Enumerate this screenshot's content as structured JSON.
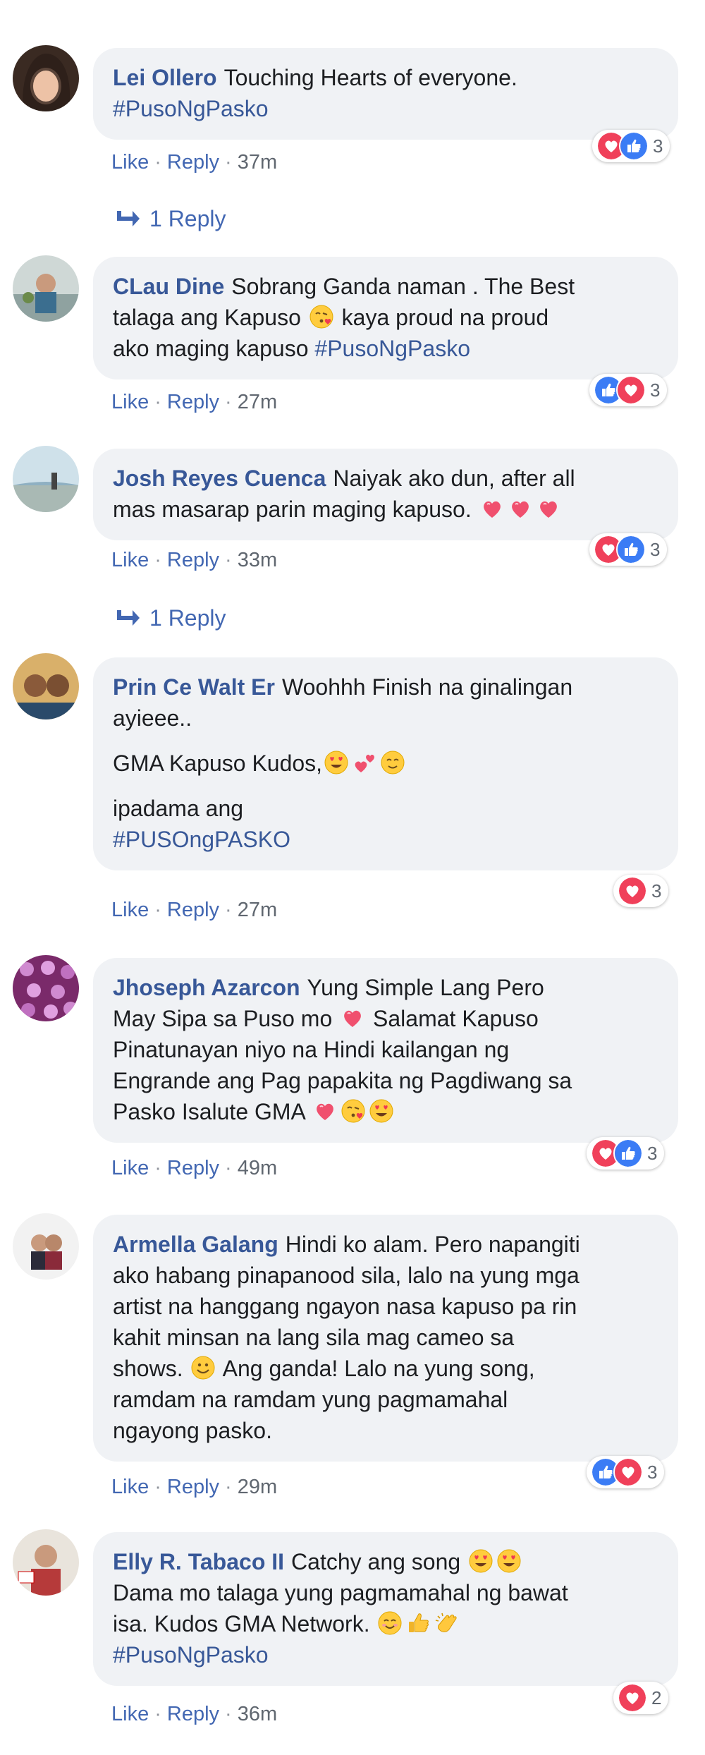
{
  "comments": [
    {
      "author": "Lei Ollero",
      "paragraphs": [
        [
          "Touching Hearts of everyone."
        ]
      ],
      "tag": "#PusoNgPasko",
      "like": "Like",
      "reply": "Reply",
      "time": "37m",
      "reactions": [
        "love",
        "like"
      ],
      "reaction_count": "3",
      "replies_label": "1 Reply"
    },
    {
      "author": "CLau Dine",
      "line1": "Sobrang Ganda naman . The Best",
      "line2": "talaga ang Kapuso",
      "line2b": "kaya proud na proud",
      "line3": "ako maging kapuso",
      "tag": "#PusoNgPasko",
      "like": "Like",
      "reply": "Reply",
      "time": "27m",
      "reactions": [
        "like",
        "love"
      ],
      "reaction_count": "3"
    },
    {
      "author": "Josh Reyes Cuenca",
      "line1": "Naiyak ako dun, after all",
      "line2": "mas masarap parin maging kapuso.",
      "like": "Like",
      "reply": "Reply",
      "time": "33m",
      "reactions": [
        "love",
        "like"
      ],
      "reaction_count": "3",
      "replies_label": "1 Reply"
    },
    {
      "author": "Prin Ce Walt Er",
      "line1": "Woohhh Finish na ginalingan",
      "line2": "ayieee..",
      "p2": "GMA Kapuso Kudos,",
      "p3": "ipadama ang",
      "tag": "#PUSOngPASKO",
      "like": "Like",
      "reply": "Reply",
      "time": "27m",
      "reactions": [
        "love"
      ],
      "reaction_count": "3"
    },
    {
      "author": "Jhoseph Azarcon",
      "line1": "Yung Simple Lang Pero",
      "line2": "May Sipa sa Puso mo",
      "line2b": "Salamat Kapuso",
      "line3": "Pinatunayan niyo na Hindi kailangan ng",
      "line4": "Engrande ang Pag papakita ng Pagdiwang sa",
      "line5": "Pasko Isalute GMA",
      "like": "Like",
      "reply": "Reply",
      "time": "49m",
      "reactions": [
        "love",
        "like"
      ],
      "reaction_count": "3"
    },
    {
      "author": "Armella Galang",
      "line1": "Hindi ko alam. Pero napangiti",
      "line2": "ako habang pinapanood sila, lalo na yung mga",
      "line3": "artist na hanggang ngayon nasa kapuso pa rin",
      "line4": "kahit minsan na lang sila mag cameo sa",
      "line5a": "shows.",
      "line5b": "Ang ganda! Lalo na yung song,",
      "line6": "ramdam na ramdam yung pagmamahal",
      "line7": "ngayong pasko.",
      "like": "Like",
      "reply": "Reply",
      "time": "29m",
      "reactions": [
        "like",
        "love"
      ],
      "reaction_count": "3"
    },
    {
      "author": "Elly R. Tabaco II",
      "line1": "Catchy ang song",
      "line2": "Dama mo talaga yung pagmamahal ng bawat",
      "line3": "isa. Kudos GMA Network.",
      "tag": "#PusoNgPasko",
      "like": "Like",
      "reply": "Reply",
      "time": "36m",
      "reactions": [
        "love"
      ],
      "reaction_count": "2"
    }
  ],
  "separator": "·",
  "colors": {
    "link": "#385898",
    "bubble": "#f0f2f5",
    "like_blue": "#3b7cf5",
    "love_red": "#f0405a"
  }
}
